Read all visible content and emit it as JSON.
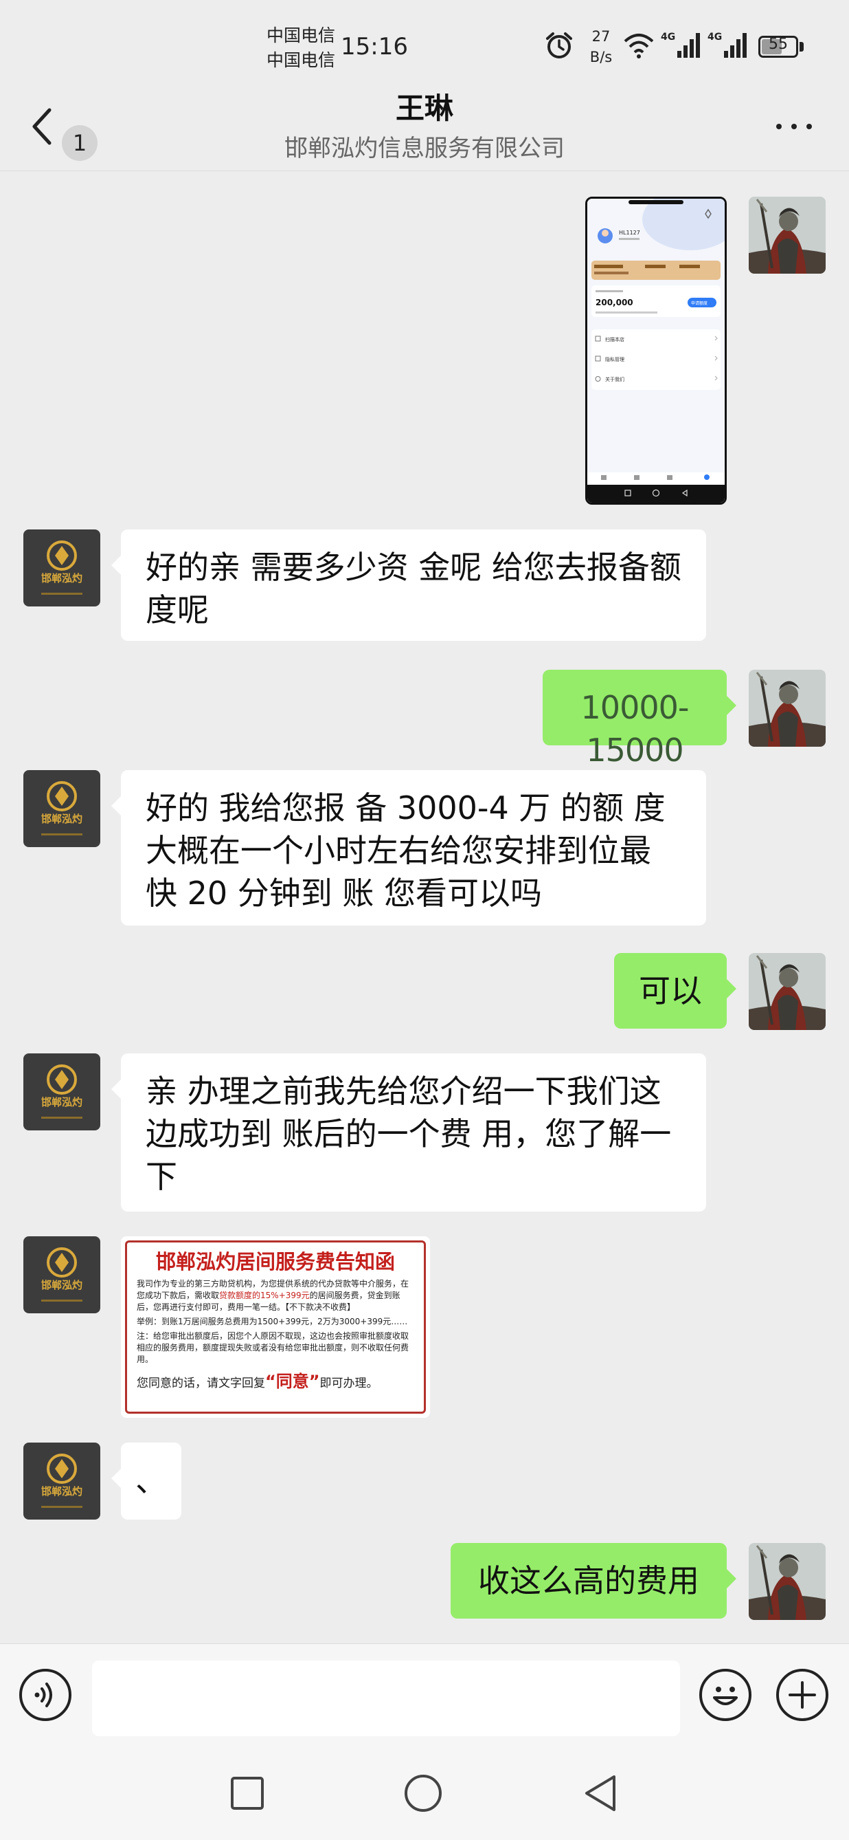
{
  "status_bar": {
    "carrier_1": "中国电信",
    "carrier_2": "中国电信",
    "time": "15:16",
    "net_speed_value": "27",
    "net_speed_unit": "B/s",
    "signal_1": "4G",
    "signal_2": "4G",
    "battery_level": "55"
  },
  "header": {
    "unread_count": "1",
    "contact_name": "王琳",
    "contact_company": "邯郸泓灼信息服务有限公司"
  },
  "messages": [
    {
      "side": "out",
      "type": "image",
      "content": "screenshot of loan app page"
    },
    {
      "side": "in",
      "type": "text",
      "text": "好的亲   需要多少资  金呢  给您去报备额  度呢"
    },
    {
      "side": "out",
      "type": "text",
      "text": "10000-15000"
    },
    {
      "side": "in",
      "type": "text",
      "text": "好的  我给您报  备 3000-4 万  的额  度大概在一个小时左右给您安排到位最快 20 分钟到  账    您看可以吗"
    },
    {
      "side": "out",
      "type": "text",
      "text": "可以"
    },
    {
      "side": "in",
      "type": "text",
      "text": "亲  办理之前我先给您介绍一下我们这边成功到  账后的一个费  用，您了解一下"
    },
    {
      "side": "in",
      "type": "image",
      "content": "service fee notice"
    },
    {
      "side": "in",
      "type": "text",
      "text": "、"
    },
    {
      "side": "out",
      "type": "text",
      "text": "收这么高的费用"
    }
  ],
  "screenshot_msg": {
    "user_id": "HL1127",
    "amount": "200,000",
    "button": "申请额度",
    "menu": [
      "扫描本店",
      "隐私管理",
      "关于我们"
    ]
  },
  "notice": {
    "title": "邯郸泓灼居间服务费告知函",
    "para1_a": "我司作为专业的第三方助贷机构，为您提供系统的代办贷款等中介服务，在您成功下款后，需收取",
    "para1_red": "贷款额度的15%+399元",
    "para1_b": "的居间服务费，贷金到账后，您再进行支付即可，费用一笔一结。【不下款决不收费】",
    "example": "举例：到账1万居间服务总费用为1500+399元，2万为3000+399元……",
    "note": "注：给您审批出额度后，因您个人原因不取现，这边也会按照审批额度收取相应的服务费用，额度提现失败或者没有给您审批出额度，则不收取任何费用。",
    "bottom_a": "您同意的话，请文字回复",
    "bottom_quote": "“同意”",
    "bottom_b": "即可办理。",
    "logo_text": "邯郸泓灼"
  },
  "colors": {
    "background": "#ededed",
    "outgoing_bubble": "#95ec69",
    "incoming_bubble": "#ffffff",
    "notice_red": "#c4201d"
  },
  "icons": {
    "back": "chevron-left-icon",
    "more": "more-dots-icon",
    "voice": "voice-icon",
    "emoji": "emoji-icon",
    "plus": "plus-icon"
  }
}
